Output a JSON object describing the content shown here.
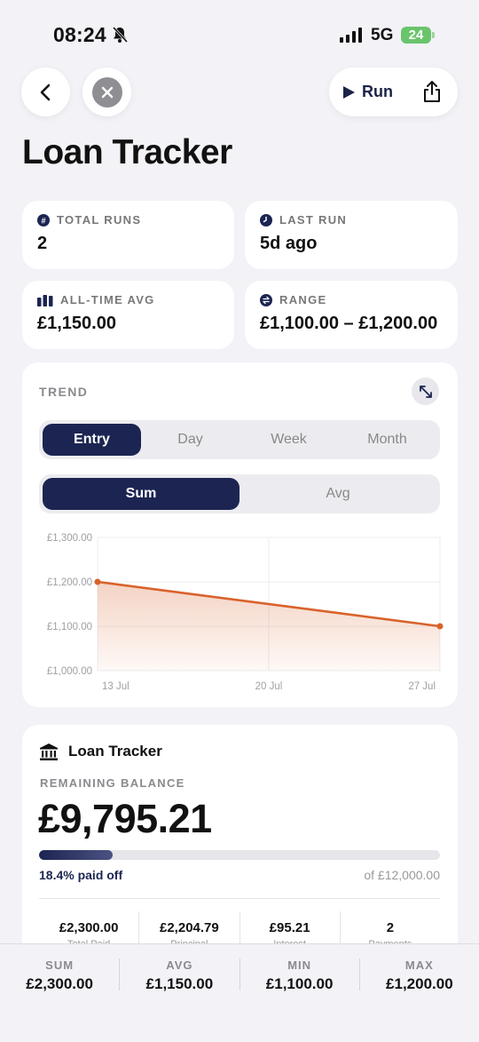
{
  "status": {
    "time": "08:24",
    "network": "5G",
    "battery": "24"
  },
  "header": {
    "title": "Loan Tracker",
    "run_label": "Run"
  },
  "stats": {
    "total_runs": {
      "label": "TOTAL RUNS",
      "value": "2"
    },
    "last_run": {
      "label": "LAST RUN",
      "value": "5d ago"
    },
    "all_time_avg": {
      "label": "ALL-TIME AVG",
      "value": "£1,150.00"
    },
    "range": {
      "label": "RANGE",
      "value": "£1,100.00 – £1,200.00"
    }
  },
  "trend": {
    "title": "TREND",
    "period_tabs": [
      "Entry",
      "Day",
      "Week",
      "Month"
    ],
    "active_period": "Entry",
    "agg_tabs": [
      "Sum",
      "Avg"
    ],
    "active_agg": "Sum"
  },
  "chart_data": {
    "type": "area",
    "x": [
      "13 Jul",
      "27 Jul"
    ],
    "x_dates": [
      "2024-07-13",
      "2024-07-27"
    ],
    "x_tick_labels": [
      "13 Jul",
      "20 Jul",
      "27 Jul"
    ],
    "values": [
      1200,
      1100
    ],
    "y_ticks": [
      "£1,300.00",
      "£1,200.00",
      "£1,100.00",
      "£1,000.00"
    ],
    "ylim": [
      1000,
      1300
    ],
    "line_color": "#d9622b",
    "grid": true
  },
  "loan": {
    "name": "Loan Tracker",
    "remaining_label": "REMAINING BALANCE",
    "remaining_value": "£9,795.21",
    "paid_fraction": 0.184,
    "paid_text": "18.4% paid off",
    "of_total": "of £12,000.00",
    "mini": [
      {
        "value": "£2,300.00",
        "label": "Total Paid"
      },
      {
        "value": "£2,204.79",
        "label": "Principal"
      },
      {
        "value": "£95.21",
        "label": "Interest"
      },
      {
        "value": "2",
        "label": "Payments"
      }
    ]
  },
  "summary": [
    {
      "label": "SUM",
      "value": "£2,300.00"
    },
    {
      "label": "AVG",
      "value": "£1,150.00"
    },
    {
      "label": "MIN",
      "value": "£1,100.00"
    },
    {
      "label": "MAX",
      "value": "£1,200.00"
    }
  ],
  "colors": {
    "navy": "#1c2552",
    "accent": "#d9622b",
    "background": "#f2f2f7"
  }
}
